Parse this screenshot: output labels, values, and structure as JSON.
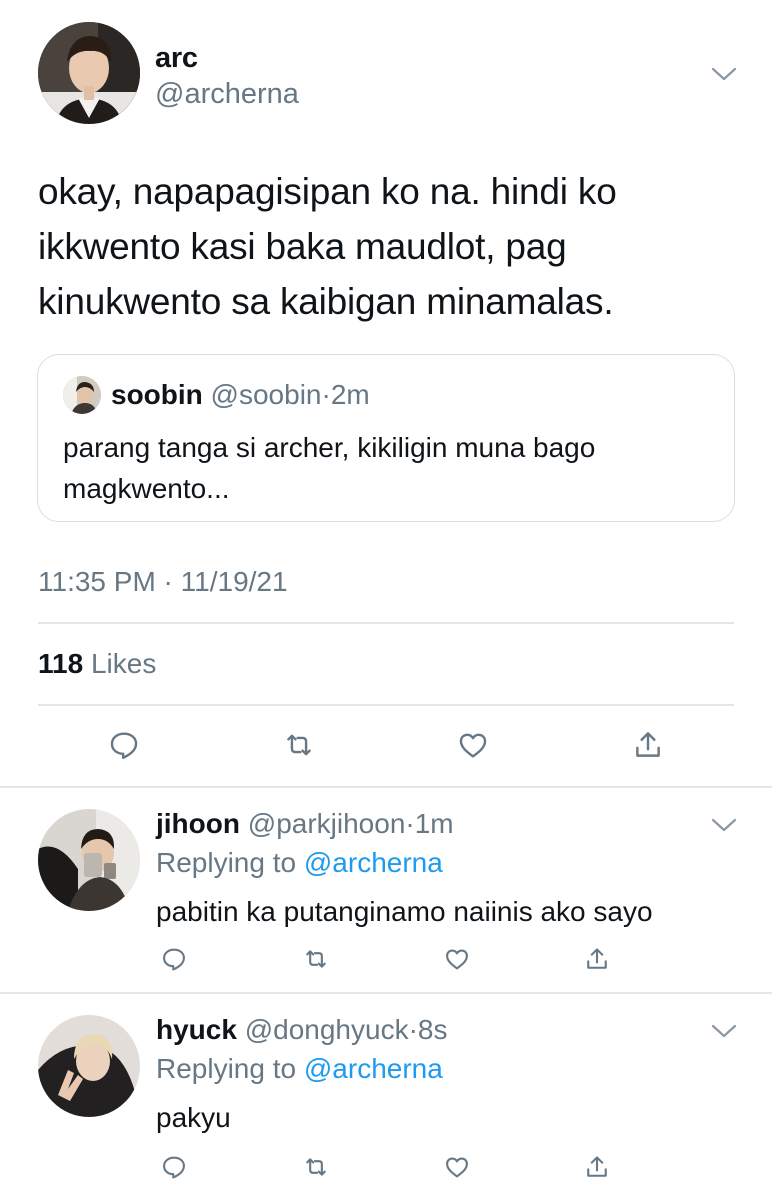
{
  "main_tweet": {
    "author_name": "arc",
    "author_handle": "@archerna",
    "text": "okay, napapagisipan ko na. hindi ko ikkwento kasi baka maudlot, pag kinukwento sa kaibigan minamalas.",
    "quoted": {
      "author_name": "soobin",
      "author_handle": "@soobin",
      "time": "2m",
      "text": "parang tanga si archer, kikiligin muna bago magkwento..."
    },
    "timestamp": "11:35 PM · 11/19/21",
    "likes_count": "118",
    "likes_label": "Likes"
  },
  "replies": [
    {
      "author_name": "jihoon",
      "author_handle": "@parkjihoon",
      "time": "1m",
      "replying_prefix": "Replying to",
      "replying_handle": "@archerna",
      "text": "pabitin ka putanginamo naiinis ako sayo"
    },
    {
      "author_name": "hyuck",
      "author_handle": "@donghyuck",
      "time": "8s",
      "replying_prefix": "Replying to",
      "replying_handle": "@archerna",
      "text": "pakyu"
    }
  ],
  "icons": {
    "reply": "comment-bubble-icon",
    "retweet": "retweet-icon",
    "like": "heart-icon",
    "share": "share-icon",
    "more": "chevron-down-icon"
  },
  "colors": {
    "text": "#0f1419",
    "muted": "#677784",
    "link": "#1d9bf0",
    "border": "#e2e6e9"
  }
}
